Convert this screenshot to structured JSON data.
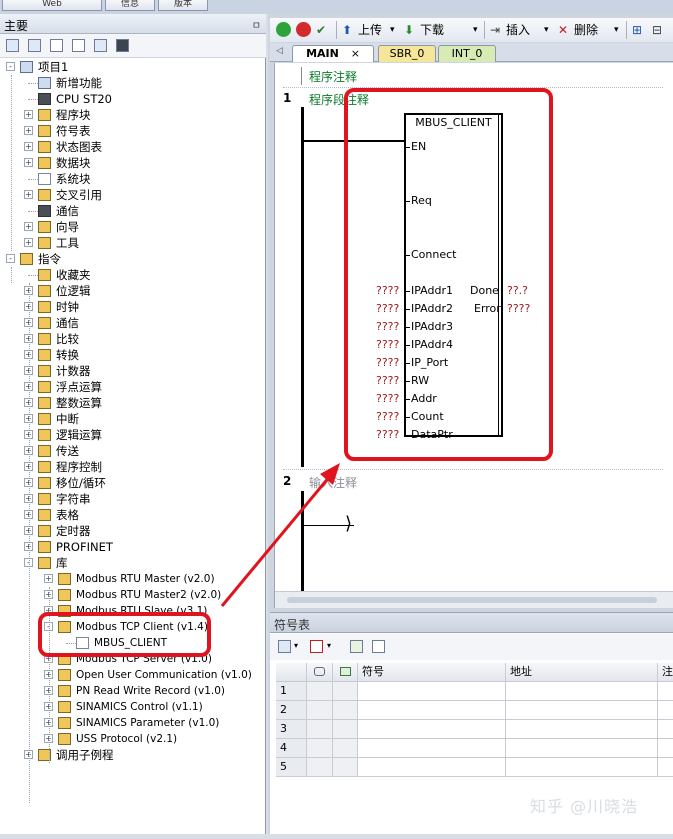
{
  "top_tabs": [
    "Web",
    "信息",
    "版本"
  ],
  "left_panel": {
    "title": "主要",
    "tree": [
      {
        "label": "项目1",
        "level": 0,
        "expand": "-",
        "icon": "project-icon"
      },
      {
        "label": "新增功能",
        "level": 1,
        "expand": "",
        "icon": "help-icon"
      },
      {
        "label": "CPU ST20",
        "level": 1,
        "expand": "",
        "icon": "cpu-icon"
      },
      {
        "label": "程序块",
        "level": 1,
        "expand": "+",
        "icon": "folder-icon"
      },
      {
        "label": "符号表",
        "level": 1,
        "expand": "+",
        "icon": "folder-icon"
      },
      {
        "label": "状态图表",
        "level": 1,
        "expand": "+",
        "icon": "folder-icon"
      },
      {
        "label": "数据块",
        "level": 1,
        "expand": "+",
        "icon": "folder-icon"
      },
      {
        "label": "系统块",
        "level": 1,
        "expand": "",
        "icon": "system-block-icon"
      },
      {
        "label": "交叉引用",
        "level": 1,
        "expand": "+",
        "icon": "folder-icon"
      },
      {
        "label": "通信",
        "level": 1,
        "expand": "",
        "icon": "communication-icon"
      },
      {
        "label": "向导",
        "level": 1,
        "expand": "+",
        "icon": "wizard-icon"
      },
      {
        "label": "工具",
        "level": 1,
        "expand": "+",
        "icon": "folder-icon"
      },
      {
        "label": "指令",
        "level": 0,
        "expand": "-",
        "icon": "instructions-icon"
      },
      {
        "label": "收藏夹",
        "level": 1,
        "expand": "",
        "icon": "favorites-icon"
      },
      {
        "label": "位逻辑",
        "level": 1,
        "expand": "+",
        "icon": "bit-logic-icon"
      },
      {
        "label": "时钟",
        "level": 1,
        "expand": "+",
        "icon": "clock-icon"
      },
      {
        "label": "通信",
        "level": 1,
        "expand": "+",
        "icon": "communication-icon"
      },
      {
        "label": "比较",
        "level": 1,
        "expand": "+",
        "icon": "compare-icon"
      },
      {
        "label": "转换",
        "level": 1,
        "expand": "+",
        "icon": "convert-icon"
      },
      {
        "label": "计数器",
        "level": 1,
        "expand": "+",
        "icon": "counter-icon"
      },
      {
        "label": "浮点运算",
        "level": 1,
        "expand": "+",
        "icon": "float-math-icon"
      },
      {
        "label": "整数运算",
        "level": 1,
        "expand": "+",
        "icon": "integer-math-icon"
      },
      {
        "label": "中断",
        "level": 1,
        "expand": "+",
        "icon": "interrupt-icon"
      },
      {
        "label": "逻辑运算",
        "level": 1,
        "expand": "+",
        "icon": "logic-op-icon"
      },
      {
        "label": "传送",
        "level": 1,
        "expand": "+",
        "icon": "move-icon"
      },
      {
        "label": "程序控制",
        "level": 1,
        "expand": "+",
        "icon": "program-control-icon"
      },
      {
        "label": "移位/循环",
        "level": 1,
        "expand": "+",
        "icon": "shift-icon"
      },
      {
        "label": "字符串",
        "level": 1,
        "expand": "+",
        "icon": "string-icon"
      },
      {
        "label": "表格",
        "level": 1,
        "expand": "+",
        "icon": "table-icon"
      },
      {
        "label": "定时器",
        "level": 1,
        "expand": "+",
        "icon": "timer-icon"
      },
      {
        "label": "PROFINET",
        "level": 1,
        "expand": "+",
        "icon": "profinet-icon"
      },
      {
        "label": "库",
        "level": 1,
        "expand": "-",
        "icon": "library-icon"
      },
      {
        "label": "Modbus RTU Master (v2.0)",
        "level": 2,
        "expand": "+",
        "icon": "folder-icon"
      },
      {
        "label": "Modbus RTU Master2 (v2.0)",
        "level": 2,
        "expand": "+",
        "icon": "folder-icon"
      },
      {
        "label": "Modbus RTU Slave (v3.1)",
        "level": 2,
        "expand": "+",
        "icon": "folder-icon"
      },
      {
        "label": "Modbus TCP Client (v1.4)",
        "level": 2,
        "expand": "-",
        "icon": "folder-icon"
      },
      {
        "label": "MBUS_CLIENT",
        "level": 3,
        "expand": "",
        "icon": "block-icon"
      },
      {
        "label": "Modbus TCP Server (v1.0)",
        "level": 2,
        "expand": "+",
        "icon": "folder-icon"
      },
      {
        "label": "Open User Communication (v1.0)",
        "level": 2,
        "expand": "+",
        "icon": "folder-icon"
      },
      {
        "label": "PN Read Write Record (v1.0)",
        "level": 2,
        "expand": "+",
        "icon": "folder-icon"
      },
      {
        "label": "SINAMICS Control (v1.1)",
        "level": 2,
        "expand": "+",
        "icon": "folder-icon"
      },
      {
        "label": "SINAMICS Parameter (v1.0)",
        "level": 2,
        "expand": "+",
        "icon": "folder-icon"
      },
      {
        "label": "USS Protocol (v2.1)",
        "level": 2,
        "expand": "+",
        "icon": "folder-icon"
      },
      {
        "label": "调用子例程",
        "level": 1,
        "expand": "+",
        "icon": "subroutine-icon"
      }
    ]
  },
  "toolbar": {
    "upload_label": "上传",
    "download_label": "下载",
    "insert_label": "插入",
    "delete_label": "删除"
  },
  "editor_tabs": [
    "MAIN",
    "SBR_0",
    "INT_0"
  ],
  "editor": {
    "program_comment": "程序注释",
    "networks": [
      {
        "number": "1",
        "comment": "程序段注释"
      },
      {
        "number": "2",
        "comment": "输入注释"
      }
    ],
    "block": {
      "name": "MBUS_CLIENT",
      "inputs": [
        "EN",
        "Req",
        "Connect",
        "IPAddr1",
        "IPAddr2",
        "IPAddr3",
        "IPAddr4",
        "IP_Port",
        "RW",
        "Addr",
        "Count",
        "DataPtr"
      ],
      "input_values": [
        "",
        "",
        "",
        "????",
        "????",
        "????",
        "????",
        "????",
        "????",
        "????",
        "????",
        "????"
      ],
      "outputs": [
        "Done",
        "Error"
      ],
      "output_values": [
        "??.?",
        "????"
      ]
    }
  },
  "symbol_table": {
    "title": "符号表",
    "columns": [
      "符号",
      "地址",
      "注"
    ],
    "rows": [
      "1",
      "2",
      "3",
      "4",
      "5"
    ]
  },
  "watermark": "知乎 @川晓浩",
  "colors": {
    "highlight": "#e0141e",
    "comment_green": "#0a7a2a",
    "unassigned_red": "#9a1a1a"
  }
}
